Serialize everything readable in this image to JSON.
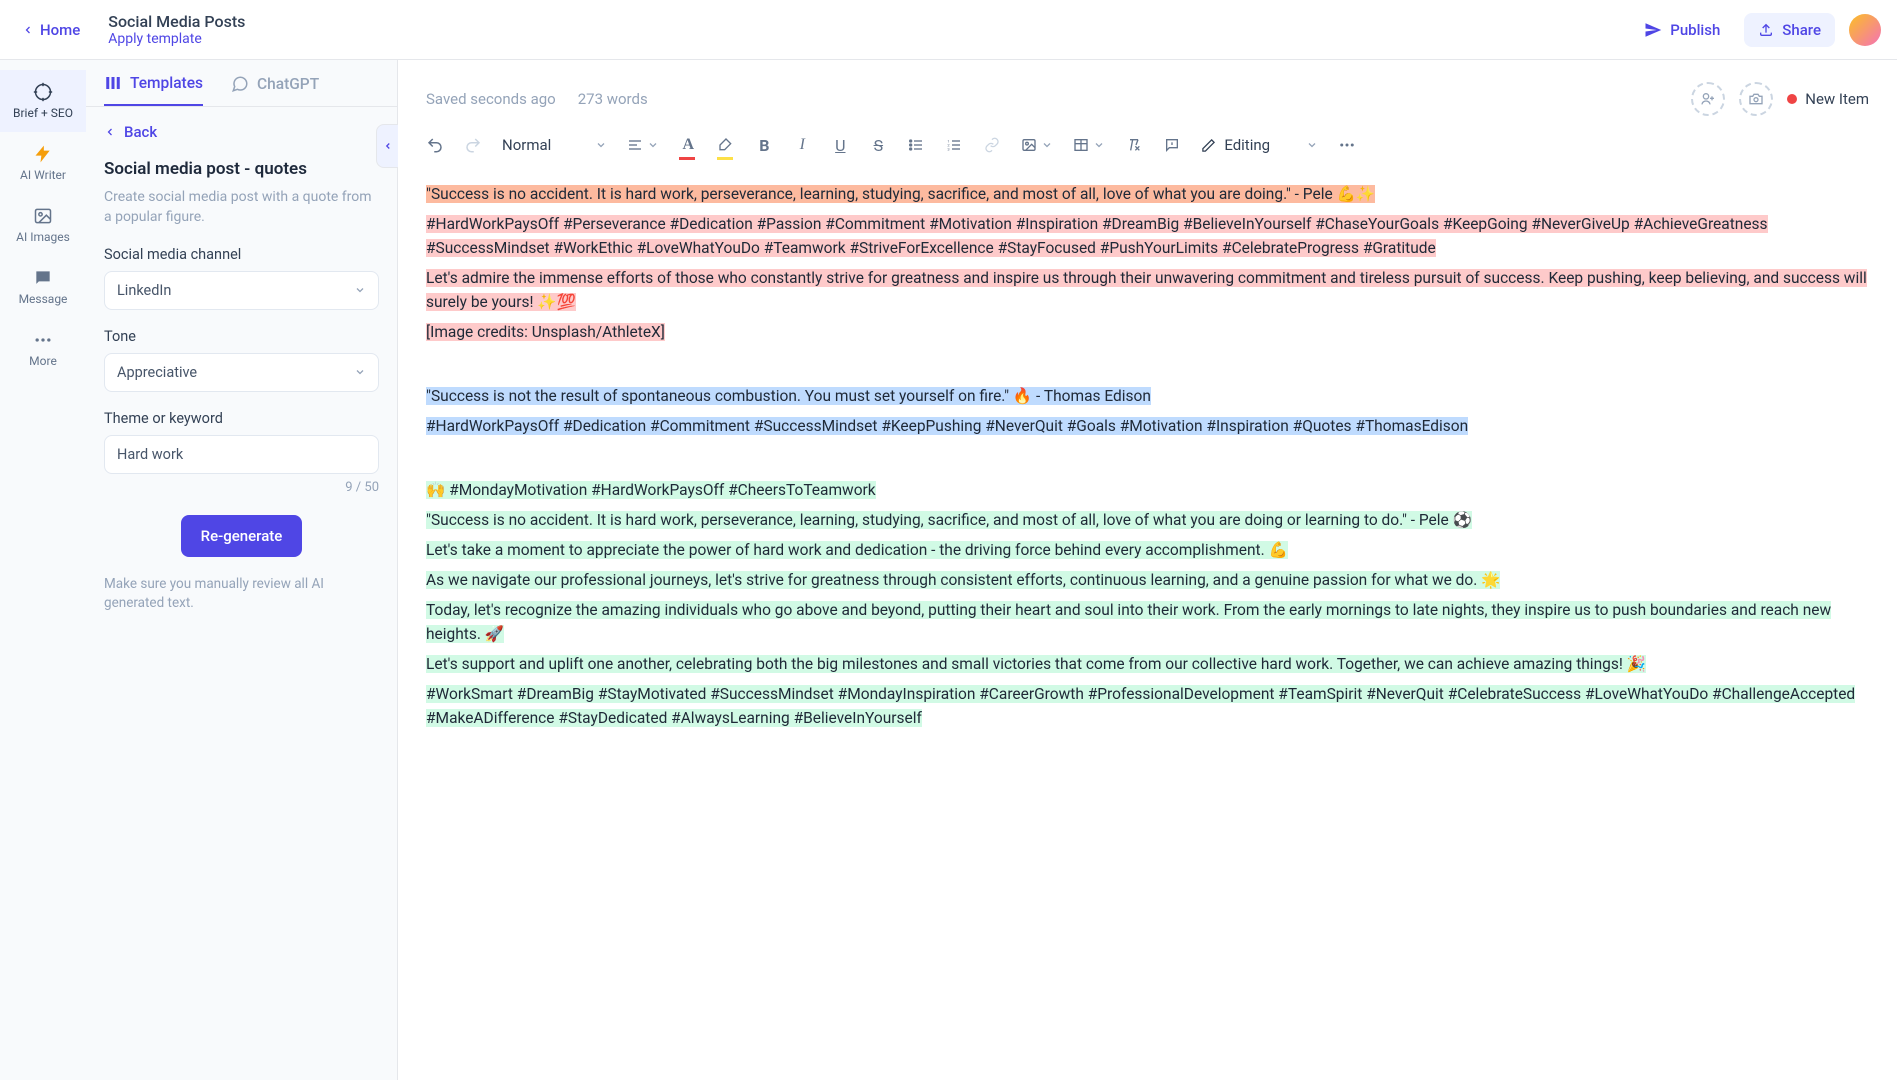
{
  "header": {
    "home": "Home",
    "title": "Social Media Posts",
    "apply_template": "Apply template",
    "publish": "Publish",
    "share": "Share"
  },
  "nav": {
    "items": [
      {
        "label": "Brief + SEO"
      },
      {
        "label": "AI Writer"
      },
      {
        "label": "AI Images"
      },
      {
        "label": "Message"
      },
      {
        "label": "More"
      }
    ]
  },
  "panel": {
    "tabs": {
      "templates": "Templates",
      "chatgpt": "ChatGPT"
    },
    "back": "Back",
    "title": "Social media post - quotes",
    "desc": "Create social media post with a quote from a popular figure.",
    "field_channel": "Social media channel",
    "channel_value": "LinkedIn",
    "field_tone": "Tone",
    "tone_value": "Appreciative",
    "field_theme": "Theme or keyword",
    "theme_value": "Hard work",
    "char_count": "9 / 50",
    "regenerate": "Re-generate",
    "note": "Make sure you manually review all AI generated text."
  },
  "editor": {
    "saved": "Saved seconds ago",
    "word_count": "273 words",
    "status": "New Item",
    "heading": "Normal",
    "editing": "Editing",
    "content": {
      "p1": "\"Success is no accident. It is hard work, perseverance, learning, studying, sacrifice, and most of all, love of what you are doing.\" - Pele 💪✨",
      "p2": "#HardWorkPaysOff #Perseverance #Dedication #Passion #Commitment #Motivation #Inspiration #DreamBig #BelieveInYourself #ChaseYourGoals #KeepGoing #NeverGiveUp #AchieveGreatness #SuccessMindset #WorkEthic #LoveWhatYouDo #Teamwork #StriveForExcellence #StayFocused #PushYourLimits #CelebrateProgress #Gratitude",
      "p3": "Let's admire the immense efforts of those who constantly strive for greatness and inspire us through their unwavering commitment and tireless pursuit of success. Keep pushing, keep believing, and success will surely be yours! ✨💯",
      "p4": "[Image credits: Unsplash/AthleteX]",
      "p5": "\"Success is not the result of spontaneous combustion. You must set yourself on fire.\" 🔥 - Thomas Edison",
      "p6": "#HardWorkPaysOff #Dedication #Commitment #SuccessMindset #KeepPushing #NeverQuit #Goals #Motivation #Inspiration #Quotes #ThomasEdison",
      "p7": "🙌 #MondayMotivation #HardWorkPaysOff #CheersToTeamwork",
      "p8": "\"Success is no accident. It is hard work, perseverance, learning, studying, sacrifice, and most of all, love of what you are doing or learning to do.\" - Pele ⚽",
      "p9": "Let's take a moment to appreciate the power of hard work and dedication - the driving force behind every accomplishment. 💪",
      "p10": "As we navigate our professional journeys, let's strive for greatness through consistent efforts, continuous learning, and a genuine passion for what we do. 🌟",
      "p11": "Today, let's recognize the amazing individuals who go above and beyond, putting their heart and soul into their work. From the early mornings to late nights, they inspire us to push boundaries and reach new heights. 🚀",
      "p12": "Let's support and uplift one another, celebrating both the big milestones and small victories that come from our collective hard work. Together, we can achieve amazing things! 🎉",
      "p13": "#WorkSmart #DreamBig #StayMotivated #SuccessMindset #MondayInspiration #CareerGrowth #ProfessionalDevelopment #TeamSpirit #NeverQuit #CelebrateSuccess #LoveWhatYouDo #ChallengeAccepted #MakeADifference #StayDedicated #AlwaysLearning #BelieveInYourself"
    }
  }
}
